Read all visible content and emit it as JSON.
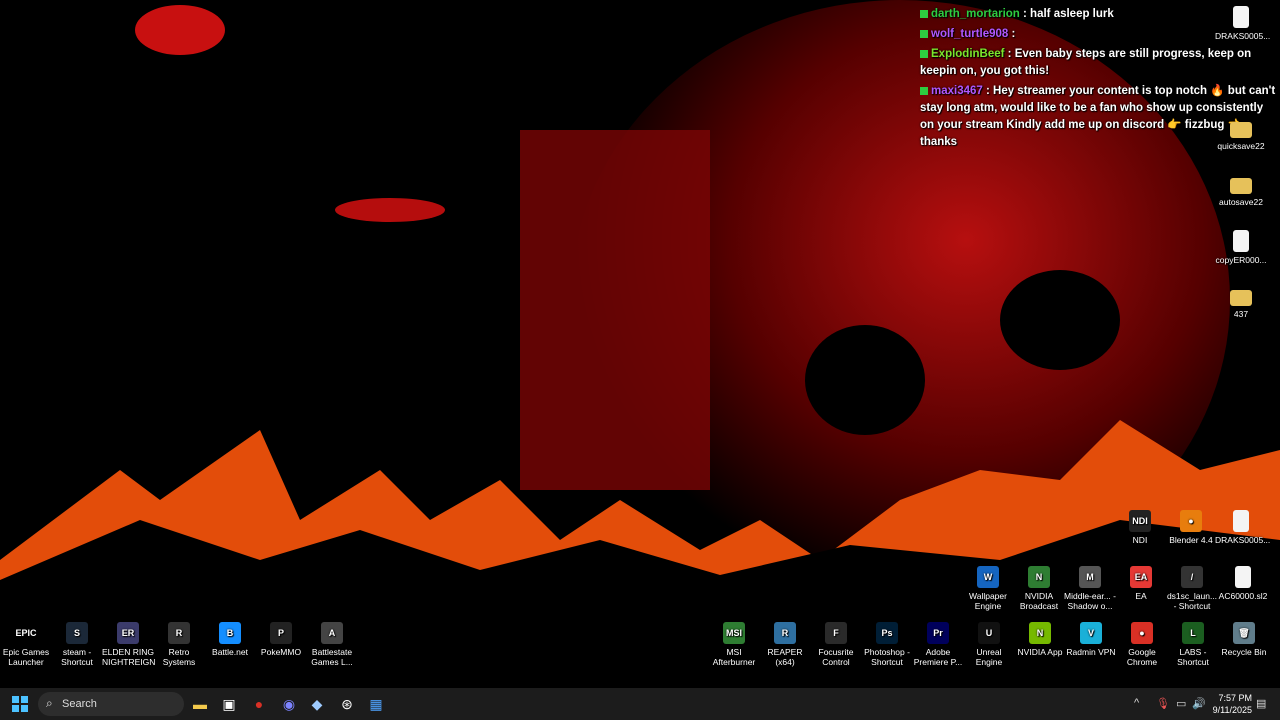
{
  "chat": [
    {
      "user": "darth_mortarion",
      "color": "#2ecc40",
      "message": "half asleep lurk"
    },
    {
      "user": "wolf_turtle908",
      "color": "#b057ff",
      "message": ""
    },
    {
      "user": "ExplodinBeef",
      "color": "#7be52c",
      "message": "Even baby steps are still progress, keep on keepin on, you got this!"
    },
    {
      "user": "maxi3467",
      "color": "#b057ff",
      "message": "Hey streamer your content is top notch 🔥 but can't stay long atm, would like to be a fan who show up consistently on your stream Kindly add me up on discord 👉 fizzbug 👈 thanks"
    }
  ],
  "desktop_right": [
    {
      "label": "DRAKS0005...",
      "kind": "file"
    },
    {
      "label": "quicksave22",
      "kind": "folder"
    },
    {
      "label": "autosave22",
      "kind": "folder"
    },
    {
      "label": "copyER000...",
      "kind": "file"
    },
    {
      "label": "437",
      "kind": "folder"
    }
  ],
  "row1": [
    {
      "label": "NDI",
      "text": "NDI",
      "color": "#222"
    },
    {
      "label": "Blender 4.4",
      "text": "●",
      "color": "#e87d0d"
    },
    {
      "label": "DRAKS0005...",
      "text": "",
      "color": "#f4f4f4"
    }
  ],
  "row2": [
    {
      "label": "Wallpaper Engine",
      "text": "W",
      "color": "#1565c0"
    },
    {
      "label": "NVIDIA Broadcast",
      "text": "N",
      "color": "#2e7d32"
    },
    {
      "label": "Middle-ear... - Shadow o...",
      "text": "M",
      "color": "#555"
    },
    {
      "label": "EA",
      "text": "EA",
      "color": "#e53935"
    },
    {
      "label": "ds1sc_laun... - Shortcut",
      "text": "/",
      "color": "#333"
    },
    {
      "label": "AC60000.sl2",
      "text": "",
      "color": "#f4f4f4"
    }
  ],
  "bottom_left": [
    {
      "label": "Epic Games Launcher",
      "text": "EPIC",
      "color": "#000"
    },
    {
      "label": "steam - Shortcut",
      "text": "S",
      "color": "#1b2838"
    },
    {
      "label": "ELDEN RING NIGHTREIGN",
      "text": "ER",
      "color": "#3b3b6b"
    },
    {
      "label": "Retro Systems",
      "text": "R",
      "color": "#333"
    },
    {
      "label": "Battle.net",
      "text": "B",
      "color": "#148eff"
    },
    {
      "label": "PokeMMO",
      "text": "P",
      "color": "#222"
    },
    {
      "label": "Battlestate Games L...",
      "text": "A",
      "color": "#444"
    }
  ],
  "bottom_right": [
    {
      "label": "MSI Afterburner",
      "text": "MSI",
      "color": "#2e7d32"
    },
    {
      "label": "REAPER (x64)",
      "text": "R",
      "color": "#2e6fa0"
    },
    {
      "label": "Focusrite Control",
      "text": "F",
      "color": "#2a2a2a"
    },
    {
      "label": "Photoshop - Shortcut",
      "text": "Ps",
      "color": "#001e36"
    },
    {
      "label": "Adobe Premiere P...",
      "text": "Pr",
      "color": "#00005b"
    },
    {
      "label": "Unreal Engine",
      "text": "U",
      "color": "#111"
    },
    {
      "label": "NVIDIA App",
      "text": "N",
      "color": "#76b900"
    },
    {
      "label": "Radmin VPN",
      "text": "V",
      "color": "#1ab0d8"
    },
    {
      "label": "Google Chrome",
      "text": "●",
      "color": "#d93025"
    },
    {
      "label": "LABS - Shortcut",
      "text": "L",
      "color": "#1b5e20"
    },
    {
      "label": "Recycle Bin",
      "text": "🗑",
      "color": "#607d8b"
    }
  ],
  "taskbar": {
    "search_label": "Search",
    "time": "7:57 PM",
    "date": "9/11/2025"
  }
}
